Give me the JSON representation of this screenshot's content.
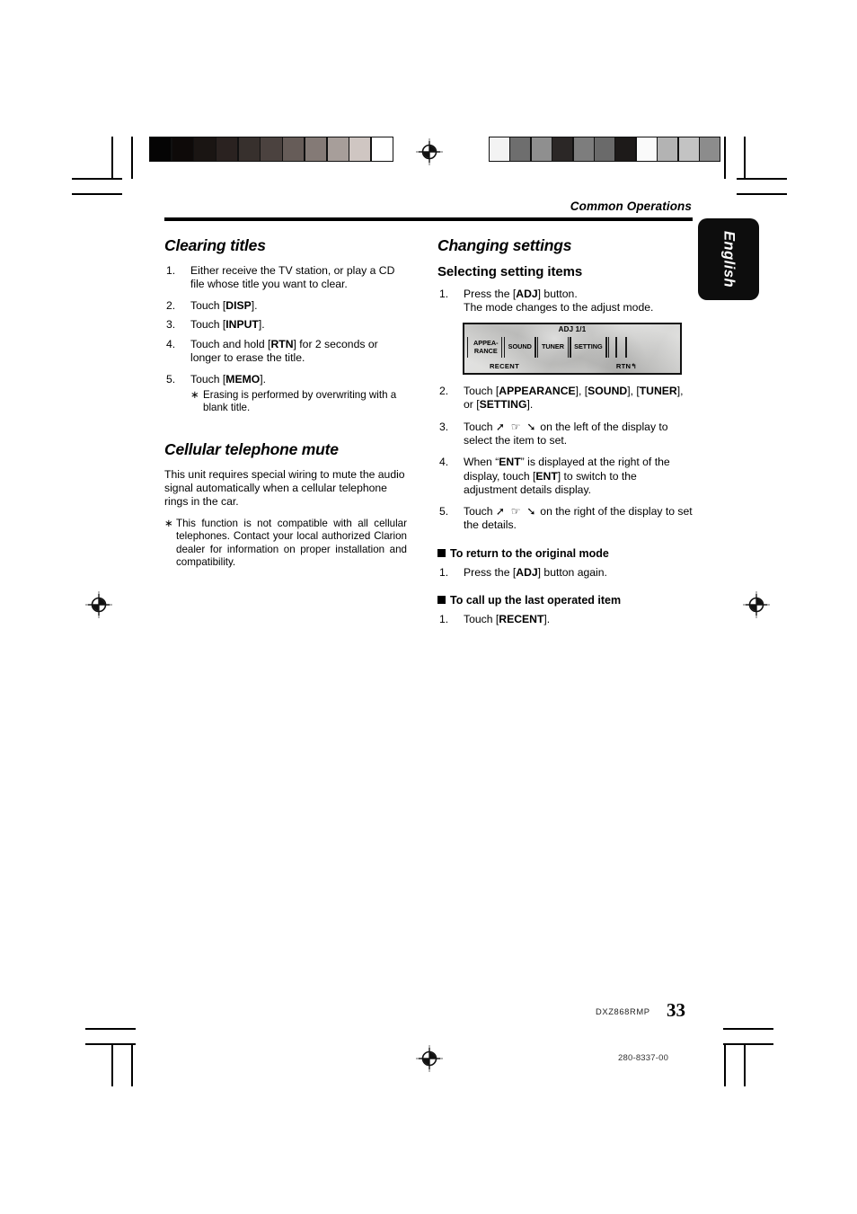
{
  "header": {
    "running_head": "Common Operations",
    "language_tab": "English"
  },
  "left_column": {
    "section_title": "Clearing titles",
    "steps": [
      {
        "num": "1.",
        "text": "Either receive the TV station, or play a CD file whose title you want to clear."
      },
      {
        "num": "2.",
        "text": "Touch [DISP]."
      },
      {
        "num": "3.",
        "text": "Touch [INPUT]."
      },
      {
        "num": "4.",
        "text": "Touch and hold [RTN] for 2 seconds or longer to erase the title."
      },
      {
        "num": "5.",
        "text": "Touch [MEMO].",
        "note": "Erasing is performed by overwriting with a blank title."
      }
    ],
    "section_title_2": "Cellular telephone mute",
    "paragraph": "This unit requires special wiring to mute the audio signal automatically when a cellular telephone rings in the car.",
    "note": "This function is not compatible with all cellular telephones. Contact your local authorized Clarion dealer for information on proper installation and compatibility.",
    "asterisk": "∗"
  },
  "right_column": {
    "section_title": "Changing settings",
    "sub_title": "Selecting setting items",
    "step1": {
      "num": "1.",
      "line1": "Press the [ADJ] button.",
      "line2": "The mode changes to the adjust mode."
    },
    "steps": [
      {
        "num": "2.",
        "text": "Touch [APPEARANCE], [SOUND], [TUNER], or [SETTING]."
      },
      {
        "num": "3.",
        "text_before": "Touch ",
        "glyphs": "➚ ☞ ➘",
        "text_after": " on the left of the display to select the item to set."
      },
      {
        "num": "4.",
        "text": "When “ENT” is displayed at the right of the display, touch [ENT] to switch to the adjustment details display."
      },
      {
        "num": "5.",
        "text_before": "Touch ",
        "glyphs": "➚ ☞ ➘",
        "text_after": " on the right of the display to set the details."
      }
    ],
    "block1": {
      "title": "To return to the original mode",
      "step_num": "1.",
      "step_text": "Press the [ADJ] button again."
    },
    "block2": {
      "title": "To call up the last operated item",
      "step_num": "1.",
      "step_text": "Touch [RECENT]."
    }
  },
  "device_display": {
    "adj_label": "ADJ 1/1",
    "buttons": [
      "APPEA-\nRANCE",
      "SOUND",
      "TUNER",
      "SETTING"
    ],
    "bottom_left": "RECENT",
    "bottom_right": "RTN↰"
  },
  "footer": {
    "model": "DXZ868RMP",
    "page_number": "33",
    "doc_code": "280-8337-00"
  },
  "calibration": {
    "left_bar": [
      "#050404",
      "#0e0a09",
      "#1a1513",
      "#2a2220",
      "#37302d",
      "#4b423f",
      "#665c58",
      "#847a76",
      "#a79e9a",
      "#cfc6c2",
      "#ffffff"
    ],
    "right_bar": [
      "#f3f3f3",
      "#6e6e6e",
      "#8f8f8f",
      "#2b2726",
      "#7d7d7d",
      "#6a6a6a",
      "#1d1a19",
      "#fafafa",
      "#b3b3b3",
      "#c3c3c3",
      "#8c8c8c"
    ]
  }
}
